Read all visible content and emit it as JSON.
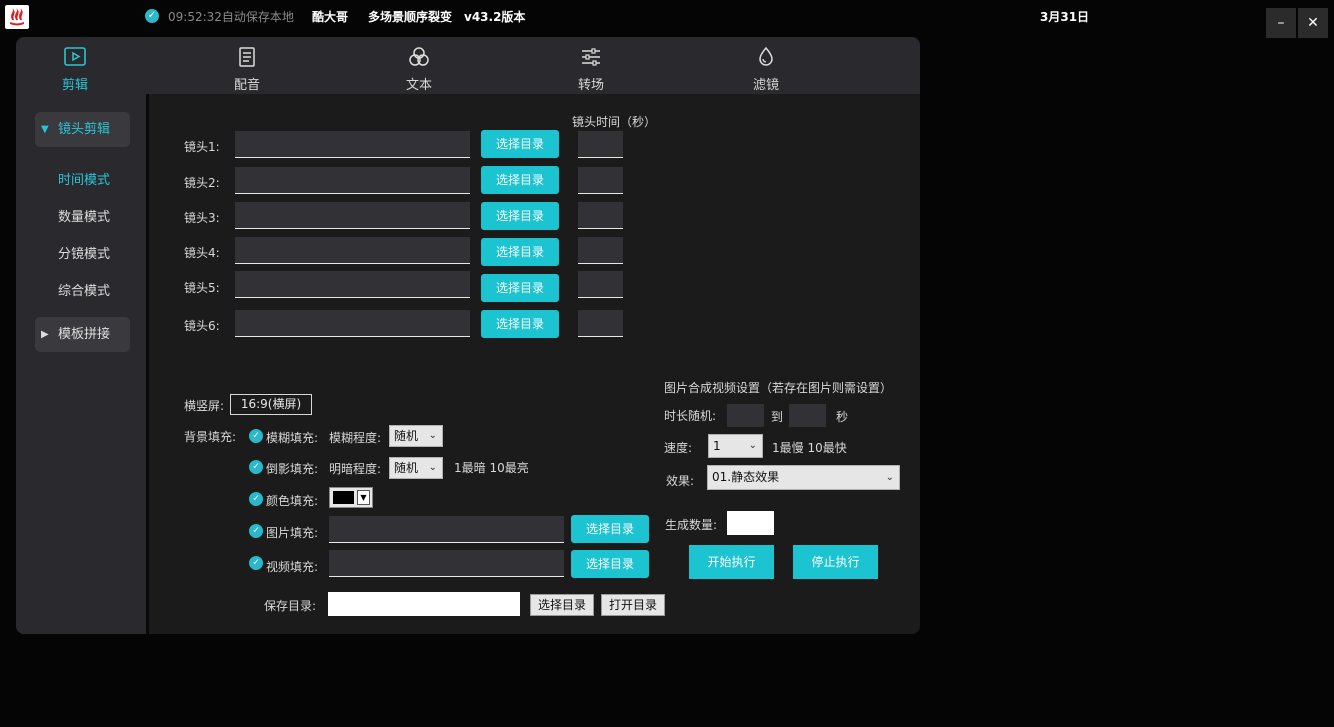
{
  "titlebar": {
    "autosave": "09:52:32自动保存本地",
    "user": "酷大哥",
    "app_name": "多场景顺序裂变",
    "version": "v43.2版本",
    "date": "3月31日",
    "minimize": "–",
    "close": "✕"
  },
  "nav": {
    "tabs": [
      {
        "label": "剪辑",
        "icon": "play-square-icon",
        "active": true
      },
      {
        "label": "配音",
        "icon": "document-icon"
      },
      {
        "label": "文本",
        "icon": "circles-icon"
      },
      {
        "label": "转场",
        "icon": "sliders-icon"
      },
      {
        "label": "滤镜",
        "icon": "filter-drop-icon"
      }
    ]
  },
  "sidebar": {
    "group1": "镜头剪辑",
    "items": [
      "时间模式",
      "数量模式",
      "分镜模式",
      "综合模式"
    ],
    "group2": "模板拼接"
  },
  "shots": {
    "time_header": "镜头时间（秒）",
    "rows": [
      {
        "label": "镜头1:",
        "button": "选择目录"
      },
      {
        "label": "镜头2:",
        "button": "选择目录"
      },
      {
        "label": "镜头3:",
        "button": "选择目录"
      },
      {
        "label": "镜头4:",
        "button": "选择目录"
      },
      {
        "label": "镜头5:",
        "button": "选择目录"
      },
      {
        "label": "镜头6:",
        "button": "选择目录"
      }
    ]
  },
  "settings": {
    "orientation_label": "横竖屏:",
    "orientation_value": "16:9(横屏)",
    "bg_fill_label": "背景填充:",
    "blur_fill": "模糊填充:",
    "blur_level_label": "模糊程度:",
    "blur_level_value": "随机",
    "reflect_fill": "倒影填充:",
    "dark_level_label": "明暗程度:",
    "dark_level_value": "随机",
    "dark_hint": "1最暗 10最亮",
    "color_fill": "颜色填充:",
    "image_fill": "图片填充:",
    "image_button": "选择目录",
    "video_fill": "视频填充:",
    "video_button": "选择目录",
    "save_dir_label": "保存目录:",
    "save_select": "选择目录",
    "save_open": "打开目录"
  },
  "image_video": {
    "title": "图片合成视频设置（若存在图片则需设置）",
    "duration_label": "时长随机:",
    "to": "到",
    "seconds": "秒",
    "speed_label": "速度:",
    "speed_value": "1",
    "speed_hint": "1最慢 10最快",
    "effect_label": "效果:",
    "effect_value": "01.静态效果",
    "count_label": "生成数量:",
    "start": "开始执行",
    "stop": "停止执行"
  },
  "colors": {
    "accent": "#1cc3d0",
    "panel": "#1b1b1b",
    "nav": "#2a2a2e"
  }
}
